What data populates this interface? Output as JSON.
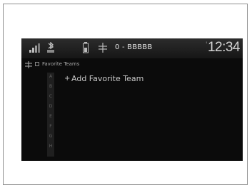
{
  "status_bar": {
    "icons": [
      "phone-signal-icon",
      "bluetooth-phone-icon",
      "battery-icon",
      "radio-signal-icon"
    ],
    "station": "0 - BBBBB",
    "clock": "12:34"
  },
  "list_header": {
    "icon": "radio-signal-icon",
    "title": "Favorite Teams"
  },
  "alpha_index": [
    "A",
    "B",
    "C",
    "D",
    "E",
    "F",
    "G",
    "H"
  ],
  "list": {
    "items": [
      {
        "icon": "plus-icon",
        "label": "Add Favorite Team"
      }
    ]
  },
  "colors": {
    "screen_bg": "#0b0b0b",
    "text": "#c9c9c9"
  }
}
